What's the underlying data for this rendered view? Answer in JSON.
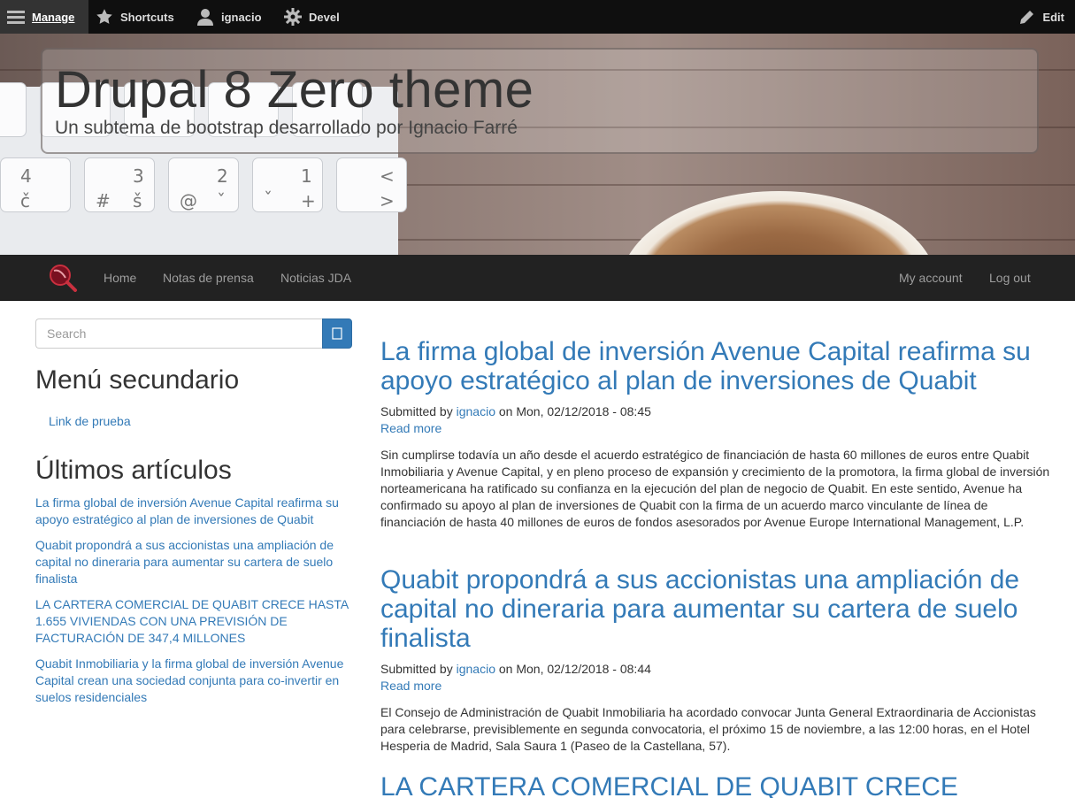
{
  "toolbar": {
    "manage": "Manage",
    "shortcuts": "Shortcuts",
    "user": "ignacio",
    "devel": "Devel",
    "edit": "Edit"
  },
  "hero": {
    "title": "Drupal 8 Zero theme",
    "subtitle": "Un subtema de bootstrap desarrollado por Ignacio Farré"
  },
  "nav": {
    "left": [
      "Home",
      "Notas de prensa",
      "Noticias JDA"
    ],
    "right": [
      "My account",
      "Log out"
    ]
  },
  "sidebar": {
    "search_placeholder": "Search",
    "menu_title": "Menú secundario",
    "menu_items": [
      "Link de prueba"
    ],
    "recent_title": "Últimos artículos",
    "recent_items": [
      "La firma global de inversión Avenue Capital reafirma su apoyo estratégico al plan de inversiones de Quabit",
      "Quabit propondrá a sus accionistas una ampliación de capital no dineraria para aumentar su cartera de suelo finalista",
      "LA CARTERA COMERCIAL DE QUABIT CRECE HASTA 1.655 VIVIENDAS CON UNA PREVISIÓN DE FACTURACIÓN DE 347,4 MILLONES",
      "Quabit Inmobiliaria y la firma global de inversión Avenue Capital crean una sociedad conjunta para co-invertir en suelos residenciales"
    ]
  },
  "articles": [
    {
      "title": "La firma global de inversión Avenue Capital reafirma su apoyo estratégico al plan de inversiones de Quabit",
      "submitted_by": "Submitted by",
      "author": "ignacio",
      "date": "on Mon, 02/12/2018 - 08:45",
      "read_more": "Read more",
      "body": "Sin cumplirse todavía un año desde el acuerdo estratégico de financiación de hasta 60 millones de euros entre Quabit Inmobiliaria y Avenue Capital, y en pleno proceso de expansión y crecimiento de la promotora, la firma global de inversión norteamericana ha ratificado su confianza en la ejecución del plan de negocio de Quabit. En este sentido, Avenue ha confirmado su apoyo al plan de inversiones de Quabit con la firma de un acuerdo marco vinculante de línea de financiación de hasta 40 millones de euros de fondos asesorados por Avenue Europe International Management, L.P."
    },
    {
      "title": "Quabit propondrá a sus accionistas una ampliación de capital no dineraria para aumentar su cartera de suelo finalista",
      "submitted_by": "Submitted by",
      "author": "ignacio",
      "date": "on Mon, 02/12/2018 - 08:44",
      "read_more": "Read more",
      "body": "El Consejo de Administración de Quabit Inmobiliaria ha acordado convocar Junta General Extraordinaria de Accionistas para celebrarse, previsiblemente en segunda convocatoria, el próximo 15 de noviembre, a las 12:00 horas, en el Hotel Hesperia de Madrid, Sala Saura 1 (Paseo de la Castellana, 57)."
    },
    {
      "title": "LA CARTERA COMERCIAL DE QUABIT CRECE"
    }
  ],
  "colors": {
    "link": "#337ab7",
    "toolbar_bg": "#0f0f0f",
    "navbar_bg": "#222222"
  }
}
